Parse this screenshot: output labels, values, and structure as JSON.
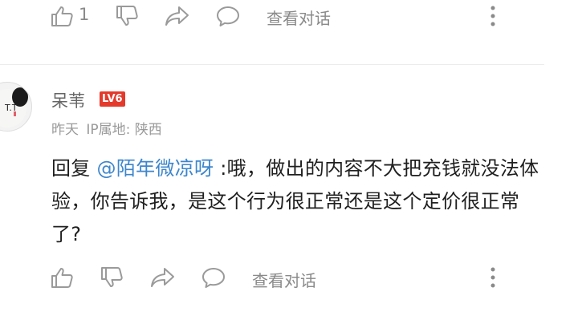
{
  "top_actions": {
    "like_count": "1",
    "view_conversation": "查看对话"
  },
  "comment": {
    "username": "呆苇",
    "level_badge": "LV6",
    "time": "昨天",
    "ip_location": "IP属地: 陕西",
    "reply_prefix": "回复 ",
    "mention": "@陌年微凉呀",
    "text": " :哦，做出的内容不大把充钱就没法体验，你告诉我，是这个行为很正常还是这个定价很正常了?"
  },
  "bottom_actions": {
    "view_conversation": "查看对话"
  },
  "colors": {
    "mention": "#3d86cc",
    "level_badge": "#e33a2c",
    "icon": "#9a9a9a"
  }
}
